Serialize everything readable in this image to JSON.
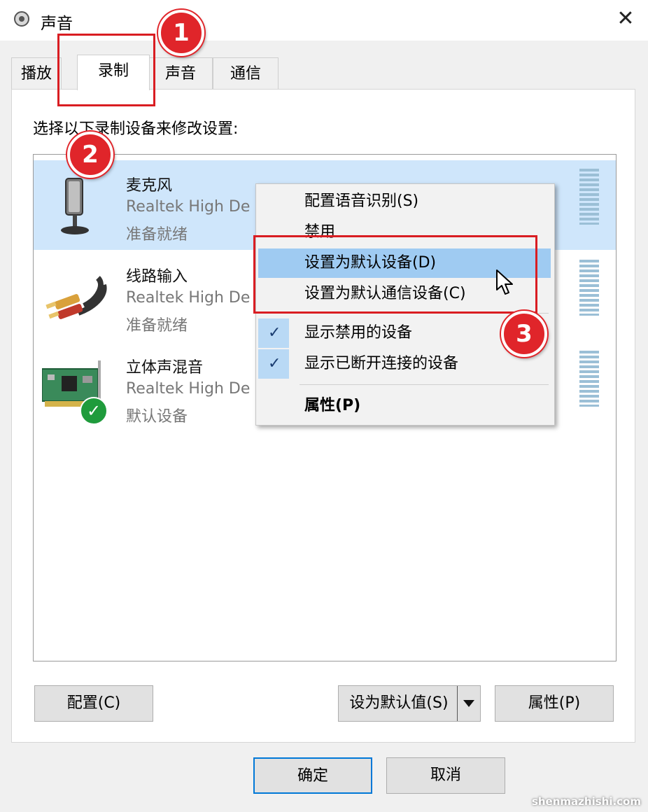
{
  "window": {
    "title": "声音"
  },
  "tabs": [
    {
      "label": "播放"
    },
    {
      "label": "录制"
    },
    {
      "label": "声音"
    },
    {
      "label": "通信"
    }
  ],
  "instruction": "选择以下录制设备来修改设置:",
  "devices": [
    {
      "name": "麦克风",
      "description": "Realtek High De",
      "status": "准备就绪",
      "icon": "microphone-icon"
    },
    {
      "name": "线路输入",
      "description": "Realtek High De",
      "status": "准备就绪",
      "icon": "rca-cable-icon"
    },
    {
      "name": "立体声混音",
      "description": "Realtek High De",
      "status": "默认设备",
      "icon": "sound-card-icon"
    }
  ],
  "context_menu": {
    "items": [
      {
        "label": "配置语音识别(S)"
      },
      {
        "label": "禁用"
      },
      {
        "label": "设置为默认设备(D)"
      },
      {
        "label": "设置为默认通信设备(C)"
      },
      {
        "label": "显示禁用的设备"
      },
      {
        "label": "显示已断开连接的设备"
      },
      {
        "label": "属性(P)"
      }
    ]
  },
  "buttons": {
    "configure": "配置(C)",
    "set_default": "设为默认值(S)",
    "properties": "属性(P)",
    "ok": "确定",
    "cancel": "取消"
  },
  "annotations": {
    "one": "1",
    "two": "2",
    "three": "3"
  },
  "watermark": "shenmazhishi.com",
  "colors": {
    "selection": "#cfe6fb",
    "menu_hover": "#9fcbf2",
    "annotation_red": "#d91d22",
    "accent": "#0078d7"
  }
}
